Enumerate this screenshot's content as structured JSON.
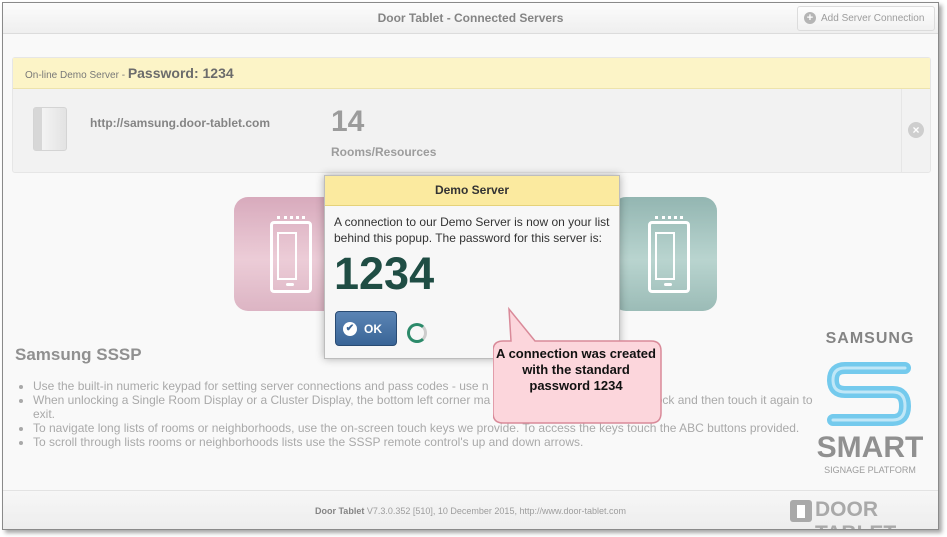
{
  "window": {
    "title": "Door Tablet - Connected Servers",
    "add_server_label": "Add Server Connection"
  },
  "server_card": {
    "heading_prefix": "On-line Demo Server -",
    "heading_password": "Password: 1234",
    "url": "http://samsung.door-tablet.com",
    "count": "14",
    "count_label": "Rooms/Resources"
  },
  "sssp": {
    "title": "Samsung SSSP",
    "items": [
      "Use the built-in numeric keypad for setting server connections and pass codes - use n",
      "When unlocking a Single Room Display or a Cluster Display, the bottom left corner ma                                              d, touch the time display to unlock and then touch it again to exit.",
      "To navigate long lists of rooms or neighborhoods, use the on-screen touch keys we provide. To access the keys touch the ABC buttons provided.",
      "To scroll through lists rooms or neighborhoods lists use the SSSP remote control's up and down arrows."
    ]
  },
  "samsung_logo": {
    "brand": "SAMSUNG",
    "smart": "SMART",
    "signage": "SIGNAGE PLATFORM"
  },
  "footer": {
    "app_name": "Door Tablet",
    "version_text": "V7.3.0.352 [510], 10 December 2015, http://www.door-tablet.com",
    "logo_text": "DOOR TABLET"
  },
  "modal": {
    "title": "Demo Server",
    "message": "A connection to our Demo Server is now on your list behind this popup. The password for this server is:",
    "password": "1234",
    "ok_label": "OK"
  },
  "callout": {
    "text": "A connection was created with the standard password 1234"
  },
  "colors": {
    "header_yellow": "#fbf0b2",
    "ok_blue": "#3a6597",
    "password_green": "#1f4d44",
    "callout_pink": "#fcd6dc",
    "samsung_blue": "#3fb6e6"
  }
}
